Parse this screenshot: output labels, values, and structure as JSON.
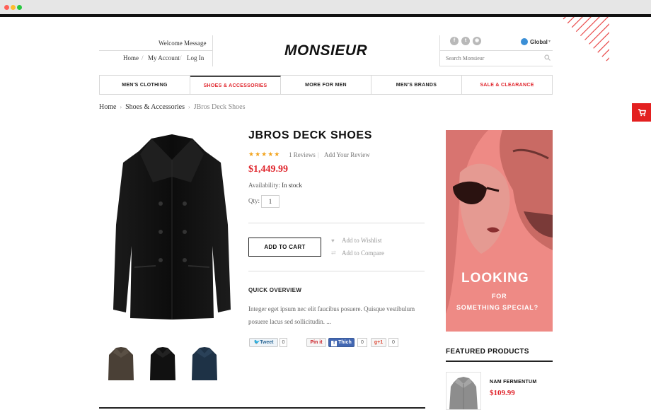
{
  "header": {
    "welcome": "Welcome Message",
    "links": [
      "Home",
      "My Account",
      "Log In"
    ],
    "separator": "/",
    "logo": "MONSIEUR",
    "social_icons": [
      "facebook-icon",
      "twitter-icon",
      "rss-icon"
    ],
    "language": "Global",
    "search_placeholder": "Search Monsieur"
  },
  "nav": {
    "items": [
      {
        "label": "Men's Clothing"
      },
      {
        "label": "Shoes & Accessories"
      },
      {
        "label": "More For Men"
      },
      {
        "label": "Men's Brands"
      },
      {
        "label": "Sale & Clearance"
      }
    ],
    "active_index": 1
  },
  "breadcrumb": [
    "Home",
    "Shoes & Accessories",
    "JBros Deck Shoes"
  ],
  "product": {
    "title": "JBROS DECK SHOES",
    "rating": 5,
    "stars": "★★★★★",
    "reviews_link": "1 Reviews",
    "review_separator": "|",
    "add_review_link": "Add Your Review",
    "price": "$1,449.99",
    "availability_label": "Availability:",
    "availability_value": "In stock",
    "qty_label": "Qty:",
    "qty_value": "1",
    "add_to_cart": "ADD TO CART",
    "wishlist": "Add to Wishlist",
    "compare": "Add to Compare",
    "overview_heading": "QUICK OVERVIEW",
    "overview_text": "Integer eget ipsum nec elit faucibus posuere. Quisque vestibulum posuere lacus sed sollicitudin. ...",
    "thumbnails": [
      "brown-coat-thumbnail",
      "black-coat-thumbnail",
      "blue-coat-thumbnail"
    ]
  },
  "share": {
    "tweet": "Tweet",
    "tweet_count": "0",
    "pinit": "Pin it",
    "like": "Thich",
    "like_count": "0",
    "gplus": "+1",
    "gplus_count": "0"
  },
  "banner": {
    "line1": "LOOKING",
    "line2": "FOR",
    "line3": "SOMETHING SPECIAL?"
  },
  "featured": {
    "heading": "FEATURED PRODUCTS",
    "items": [
      {
        "name": "NAM FERMENTUM",
        "price": "$109.99"
      }
    ]
  },
  "colors": {
    "accent_red": "#e0262d",
    "banner_pink": "#f0847f",
    "cart_tab": "#e32020",
    "chrome_dots": [
      "#ff5f57",
      "#febc2e",
      "#28c840"
    ]
  }
}
